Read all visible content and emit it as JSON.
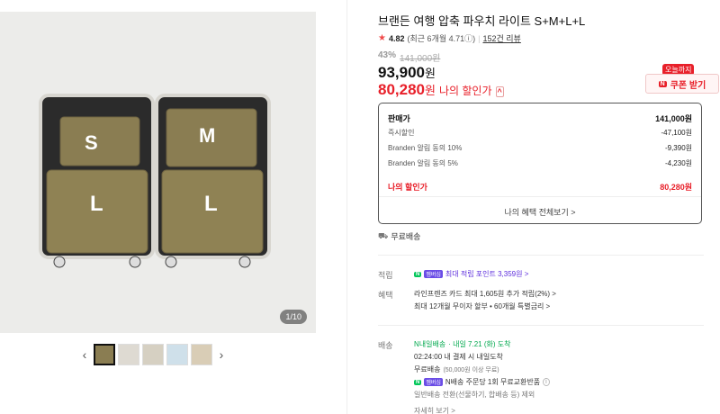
{
  "gallery": {
    "counter": "1/10",
    "labels": {
      "s": "S",
      "m": "M",
      "l1": "L",
      "l2": "L"
    },
    "prev": "‹",
    "next": "›",
    "thumb_count": 5
  },
  "product": {
    "title": "브랜든 여행 압축 파우치 라이트 S+M+L+L",
    "rating": "4.82",
    "rating_note": "(최근 6개월 4.71ⓘ)",
    "separator": "|",
    "reviews": "152건 리뷰",
    "discount_pct": "43%",
    "original_price": "141,000원",
    "price": "93,900",
    "price_unit": "원",
    "my_price": "80,280",
    "my_price_unit": "원",
    "my_price_label": "나의 할인가",
    "my_price_toggle": "^"
  },
  "coupon": {
    "badge": "오늘까지",
    "n_mark": "N",
    "label": "쿠폰 받기"
  },
  "benefits": {
    "rows": [
      {
        "label": "판매가",
        "value": "141,000원"
      },
      {
        "label": "즉시할인",
        "value": "-47,100원"
      },
      {
        "label": "Branden 알림 동의 10%",
        "value": "-9,390원"
      },
      {
        "label": "Branden 알림 동의 5%",
        "value": "-4,230원"
      }
    ],
    "my_label": "나의 할인가",
    "my_value": "80,280원",
    "view_all": "나의 혜택 전체보기 >"
  },
  "shipping_free": "무료배송",
  "points": {
    "label": "적립",
    "badge_n": "N",
    "badge_ship": "멤버십",
    "text": "최대 적립 포인트 3,359원 >"
  },
  "perks": {
    "label": "혜택",
    "line1": "라인프렌즈 카드 최대 1,605원 추가 적립(2%) >",
    "line2": "최대 12개월 무이자 할부 • 60개월 특별금리 >"
  },
  "delivery": {
    "label": "배송",
    "brand": "N내일배송",
    "eta": "· 내일 7.21 (화) 도착",
    "countdown": "02:24:00  내 결제 시 내일도착",
    "free": "무료배송",
    "free_note": "(50,000원 이상 무료)",
    "n_return": "N배송 주문당 1회 무료교환반품",
    "exclude": "일반배송 전환(선물하기, 합배송 등) 제외",
    "more": "자세히 보기 >"
  },
  "colors": {
    "accent_red": "#e8202a",
    "naver_green": "#03c75a",
    "membership_purple": "#5b2bdc"
  }
}
